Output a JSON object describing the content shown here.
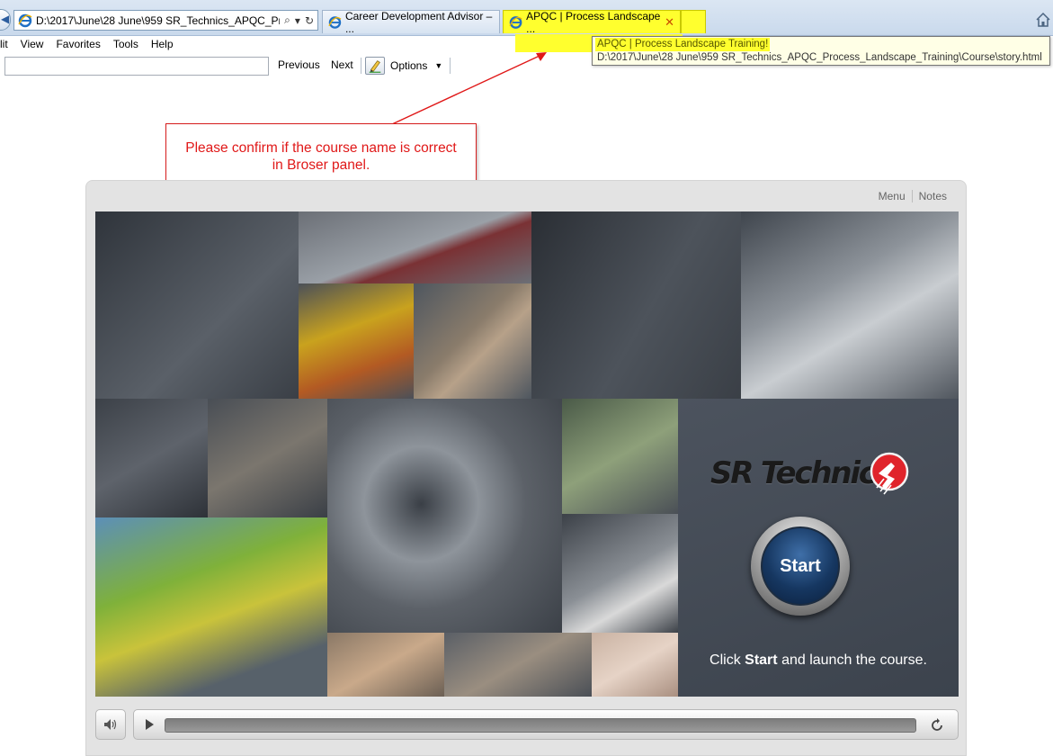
{
  "browser": {
    "address_url": "D:\\2017\\June\\28 June\\959 SR_Technics_APQC_Pr",
    "tabs": [
      {
        "label": "Career Development Advisor – ..."
      },
      {
        "label": "APQC | Process Landscape ...",
        "close": "✕"
      }
    ],
    "menu": [
      "lit",
      "View",
      "Favorites",
      "Tools",
      "Help"
    ],
    "find": {
      "value": "",
      "previous": "Previous",
      "next": "Next",
      "options": "Options"
    },
    "tooltip": {
      "title": "APQC | Process Landscape Training!",
      "path": "D:\\2017\\June\\28 June\\959 SR_Technics_APQC_Process_Landscape_Training\\Course\\story.html"
    },
    "highlight_color": "#ffff2e"
  },
  "annotation": {
    "text_line1": "Please confirm if the course name is correct",
    "text_line2": "in Broser panel.",
    "color": "#e01818"
  },
  "player": {
    "top_links": [
      "Menu",
      "Notes"
    ],
    "logo_text": "SR Technics",
    "start_label": "Start",
    "launch_prefix": "Click",
    "launch_bold": "Start",
    "launch_suffix": "and launch the course."
  },
  "icons": {
    "back": "back-arrow-icon",
    "ie": "internet-explorer-icon",
    "search": "search-icon",
    "refresh": "refresh-icon",
    "home": "home-icon",
    "close": "close-icon",
    "options": "pencil-icon",
    "mute": "speaker-icon",
    "play": "play-icon",
    "replay": "replay-icon",
    "brand": "sr-technics-logo-icon"
  }
}
